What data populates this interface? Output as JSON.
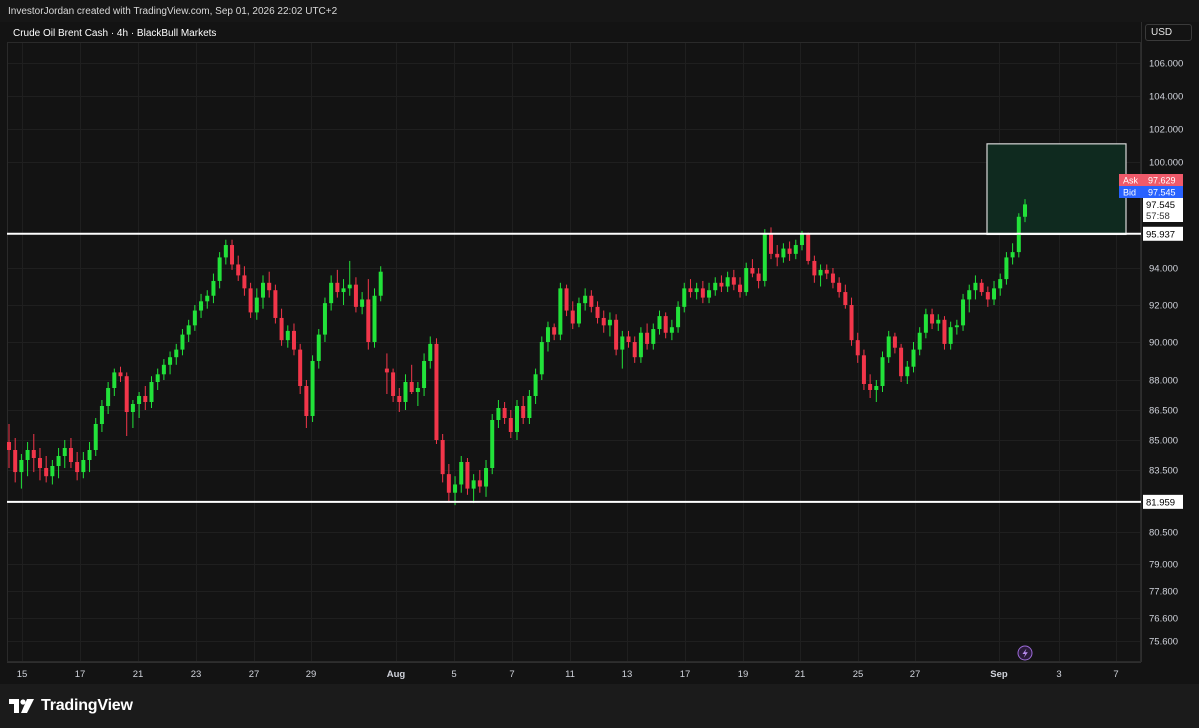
{
  "header": {
    "created_by": "InvestorJordan created with TradingView.com, Sep 01, 2026 22:02 UTC+2"
  },
  "chart_title": "Crude Oil Brent Cash · 4h · BlackBull Markets",
  "currency": "USD",
  "brand": {
    "name": "TradingView"
  },
  "colors": {
    "up": "#22e23a",
    "down": "#f2364a",
    "background": "#131313",
    "grid": "#1f1f1f",
    "ask": "#f05a6a",
    "bid": "#2962ff",
    "zone_fill": "#0f2a1f"
  },
  "chart_data": {
    "type": "candlestick",
    "instrument": "Crude Oil Brent Cash",
    "timeframe": "4h",
    "broker": "BlackBull Markets",
    "y_axis": {
      "range": [
        74.8,
        108.9
      ],
      "ticks": [
        "106.000",
        "104.000",
        "102.000",
        "100.000",
        "94.000",
        "92.000",
        "90.000",
        "88.000",
        "86.500",
        "85.000",
        "83.500",
        "80.500",
        "79.000",
        "77.800",
        "76.600",
        "75.600"
      ]
    },
    "x_axis": {
      "ticks": [
        "15",
        "17",
        "21",
        "23",
        "27",
        "29",
        "Aug",
        "5",
        "7",
        "11",
        "13",
        "17",
        "19",
        "21",
        "25",
        "27",
        "Sep",
        "3",
        "7"
      ]
    },
    "horizontal_levels": [
      {
        "price": 95.937,
        "label": "95.937"
      },
      {
        "price": 81.959,
        "label": "81.959"
      }
    ],
    "target_zone": {
      "top": 101.1,
      "bottom": 95.9,
      "from_date": "Sep 1",
      "to_date": "Sep 6"
    },
    "quote": {
      "ask_label": "Ask",
      "ask": "97.629",
      "bid_label": "Bid",
      "bid": "97.545",
      "last": "97.545",
      "countdown": "57:58"
    },
    "candles": [
      [
        84.9,
        85.8,
        83.6,
        84.5
      ],
      [
        84.5,
        85.1,
        82.9,
        83.4
      ],
      [
        83.4,
        84.3,
        82.6,
        84.0
      ],
      [
        84.0,
        84.9,
        83.2,
        84.5
      ],
      [
        84.5,
        85.3,
        83.4,
        84.1
      ],
      [
        84.1,
        84.6,
        83.0,
        83.6
      ],
      [
        83.6,
        84.2,
        82.9,
        83.2
      ],
      [
        83.2,
        84.0,
        82.8,
        83.7
      ],
      [
        83.7,
        84.6,
        83.1,
        84.2
      ],
      [
        84.2,
        85.0,
        83.6,
        84.6
      ],
      [
        84.6,
        85.1,
        83.6,
        83.9
      ],
      [
        83.9,
        84.4,
        83.0,
        83.4
      ],
      [
        83.4,
        84.4,
        83.1,
        84.0
      ],
      [
        84.0,
        84.9,
        83.4,
        84.5
      ],
      [
        84.5,
        86.1,
        84.2,
        85.8
      ],
      [
        85.8,
        87.0,
        85.4,
        86.7
      ],
      [
        86.7,
        87.9,
        86.3,
        87.6
      ],
      [
        87.6,
        88.6,
        87.2,
        88.4
      ],
      [
        88.4,
        88.7,
        87.9,
        88.2
      ],
      [
        88.2,
        88.4,
        85.2,
        86.4
      ],
      [
        86.4,
        87.0,
        85.6,
        86.8
      ],
      [
        86.8,
        87.4,
        86.1,
        87.2
      ],
      [
        87.2,
        87.7,
        86.5,
        86.9
      ],
      [
        86.9,
        88.2,
        86.6,
        87.9
      ],
      [
        87.9,
        88.6,
        87.5,
        88.3
      ],
      [
        88.3,
        89.1,
        88.0,
        88.8
      ],
      [
        88.8,
        89.5,
        88.3,
        89.2
      ],
      [
        89.2,
        89.9,
        88.8,
        89.6
      ],
      [
        89.6,
        90.7,
        89.3,
        90.4
      ],
      [
        90.4,
        91.2,
        90.0,
        90.9
      ],
      [
        90.9,
        92.0,
        90.6,
        91.7
      ],
      [
        91.7,
        92.6,
        91.3,
        92.2
      ],
      [
        92.2,
        92.8,
        91.8,
        92.5
      ],
      [
        92.5,
        93.7,
        92.1,
        93.3
      ],
      [
        93.3,
        94.9,
        92.9,
        94.6
      ],
      [
        94.6,
        95.6,
        94.2,
        95.3
      ],
      [
        95.3,
        95.6,
        93.9,
        94.2
      ],
      [
        94.2,
        94.7,
        93.3,
        93.6
      ],
      [
        93.6,
        94.1,
        92.5,
        92.9
      ],
      [
        92.9,
        93.2,
        91.3,
        91.6
      ],
      [
        91.6,
        92.9,
        91.2,
        92.4
      ],
      [
        92.4,
        93.6,
        91.8,
        93.2
      ],
      [
        93.2,
        93.8,
        92.4,
        92.8
      ],
      [
        92.8,
        93.1,
        91.0,
        91.3
      ],
      [
        91.3,
        91.8,
        89.8,
        90.1
      ],
      [
        90.1,
        90.9,
        89.7,
        90.6
      ],
      [
        90.6,
        91.0,
        89.3,
        89.6
      ],
      [
        89.6,
        89.9,
        87.3,
        87.7
      ],
      [
        87.7,
        88.0,
        85.6,
        86.2
      ],
      [
        86.2,
        89.3,
        85.9,
        89.0
      ],
      [
        89.0,
        90.7,
        88.6,
        90.4
      ],
      [
        90.4,
        92.4,
        90.0,
        92.1
      ],
      [
        92.1,
        93.6,
        91.7,
        93.2
      ],
      [
        93.2,
        93.9,
        92.4,
        92.7
      ],
      [
        92.7,
        93.4,
        92.0,
        92.9
      ],
      [
        92.9,
        94.4,
        92.5,
        93.1
      ],
      [
        93.1,
        93.5,
        91.6,
        91.9
      ],
      [
        91.9,
        92.7,
        91.5,
        92.3
      ],
      [
        92.3,
        93.4,
        89.6,
        90.0
      ],
      [
        90.0,
        92.9,
        89.7,
        92.5
      ],
      [
        92.5,
        94.1,
        92.2,
        93.8
      ],
      [
        88.6,
        89.4,
        87.3,
        88.4
      ],
      [
        88.4,
        88.6,
        86.9,
        87.2
      ],
      [
        87.2,
        87.6,
        86.4,
        86.9
      ],
      [
        86.9,
        88.3,
        86.5,
        87.9
      ],
      [
        87.9,
        88.8,
        87.3,
        87.4
      ],
      [
        87.4,
        87.9,
        86.7,
        87.6
      ],
      [
        87.6,
        89.4,
        87.2,
        89.0
      ],
      [
        89.0,
        90.3,
        88.6,
        89.9
      ],
      [
        89.9,
        90.2,
        84.8,
        85.0
      ],
      [
        85.0,
        85.3,
        82.9,
        83.3
      ],
      [
        83.3,
        83.8,
        82.0,
        82.4
      ],
      [
        82.4,
        83.2,
        81.8,
        82.8
      ],
      [
        82.8,
        84.2,
        82.4,
        83.9
      ],
      [
        83.9,
        84.1,
        82.3,
        82.6
      ],
      [
        82.6,
        83.3,
        81.9,
        83.0
      ],
      [
        83.0,
        83.5,
        82.4,
        82.7
      ],
      [
        82.7,
        84.0,
        82.2,
        83.6
      ],
      [
        83.6,
        86.3,
        83.3,
        86.0
      ],
      [
        86.0,
        87.0,
        85.6,
        86.6
      ],
      [
        86.6,
        86.9,
        85.8,
        86.1
      ],
      [
        86.1,
        86.5,
        85.1,
        85.4
      ],
      [
        85.4,
        87.0,
        85.0,
        86.7
      ],
      [
        86.7,
        87.2,
        85.8,
        86.1
      ],
      [
        86.1,
        87.5,
        85.8,
        87.2
      ],
      [
        87.2,
        88.6,
        86.8,
        88.3
      ],
      [
        88.3,
        90.3,
        88.0,
        90.0
      ],
      [
        90.0,
        91.1,
        89.5,
        90.8
      ],
      [
        90.8,
        91.0,
        90.1,
        90.4
      ],
      [
        90.4,
        93.2,
        90.1,
        92.9
      ],
      [
        92.9,
        93.1,
        91.4,
        91.7
      ],
      [
        91.7,
        92.2,
        90.7,
        91.0
      ],
      [
        91.0,
        92.4,
        90.8,
        92.1
      ],
      [
        92.1,
        92.9,
        91.7,
        92.5
      ],
      [
        92.5,
        92.8,
        91.6,
        91.9
      ],
      [
        91.9,
        92.2,
        91.0,
        91.3
      ],
      [
        91.3,
        91.7,
        90.5,
        90.9
      ],
      [
        90.9,
        91.6,
        90.3,
        91.2
      ],
      [
        91.2,
        91.5,
        89.3,
        89.6
      ],
      [
        89.6,
        90.6,
        88.6,
        90.3
      ],
      [
        90.3,
        90.6,
        89.7,
        90.0
      ],
      [
        90.0,
        90.3,
        88.9,
        89.2
      ],
      [
        89.2,
        90.8,
        88.9,
        90.5
      ],
      [
        90.5,
        91.0,
        89.6,
        89.9
      ],
      [
        89.9,
        91.0,
        89.6,
        90.7
      ],
      [
        90.7,
        91.7,
        90.4,
        91.4
      ],
      [
        91.4,
        91.6,
        90.2,
        90.5
      ],
      [
        90.5,
        91.2,
        90.1,
        90.8
      ],
      [
        90.8,
        92.2,
        90.5,
        91.9
      ],
      [
        91.9,
        93.2,
        91.6,
        92.9
      ],
      [
        92.9,
        93.4,
        92.4,
        92.7
      ],
      [
        92.7,
        93.2,
        92.3,
        92.9
      ],
      [
        92.9,
        93.3,
        92.1,
        92.4
      ],
      [
        92.4,
        93.2,
        92.1,
        92.8
      ],
      [
        92.8,
        93.5,
        92.5,
        93.2
      ],
      [
        93.2,
        93.6,
        92.7,
        93.0
      ],
      [
        93.0,
        93.8,
        92.7,
        93.5
      ],
      [
        93.5,
        93.9,
        92.8,
        93.1
      ],
      [
        93.1,
        93.5,
        92.4,
        92.7
      ],
      [
        92.7,
        94.3,
        92.5,
        94.0
      ],
      [
        94.0,
        94.5,
        93.5,
        93.7
      ],
      [
        93.7,
        94.0,
        92.9,
        93.3
      ],
      [
        93.3,
        96.2,
        93.0,
        95.9
      ],
      [
        95.9,
        96.3,
        94.5,
        94.8
      ],
      [
        94.8,
        95.3,
        94.1,
        94.6
      ],
      [
        94.6,
        95.4,
        94.3,
        95.1
      ],
      [
        95.1,
        95.5,
        94.4,
        94.8
      ],
      [
        94.8,
        95.6,
        94.5,
        95.3
      ],
      [
        95.3,
        96.1,
        95.0,
        95.9
      ],
      [
        95.9,
        96.0,
        94.2,
        94.4
      ],
      [
        94.4,
        94.7,
        93.2,
        93.6
      ],
      [
        93.6,
        94.2,
        93.0,
        93.9
      ],
      [
        93.9,
        94.2,
        93.4,
        93.7
      ],
      [
        93.7,
        94.0,
        92.9,
        93.2
      ],
      [
        93.2,
        93.5,
        92.4,
        92.7
      ],
      [
        92.7,
        93.1,
        91.8,
        92.0
      ],
      [
        92.0,
        92.4,
        89.8,
        90.1
      ],
      [
        90.1,
        90.5,
        88.9,
        89.3
      ],
      [
        89.3,
        89.6,
        87.5,
        87.8
      ],
      [
        87.8,
        88.3,
        87.1,
        87.5
      ],
      [
        87.5,
        88.0,
        86.9,
        87.7
      ],
      [
        87.7,
        89.5,
        87.4,
        89.2
      ],
      [
        89.2,
        90.6,
        88.9,
        90.3
      ],
      [
        90.3,
        90.5,
        89.4,
        89.7
      ],
      [
        89.7,
        89.9,
        87.9,
        88.2
      ],
      [
        88.2,
        89.0,
        87.8,
        88.7
      ],
      [
        88.7,
        90.0,
        88.4,
        89.6
      ],
      [
        89.6,
        90.8,
        89.3,
        90.5
      ],
      [
        90.5,
        91.8,
        90.2,
        91.5
      ],
      [
        91.5,
        91.8,
        90.7,
        91.0
      ],
      [
        91.0,
        91.5,
        90.6,
        91.2
      ],
      [
        91.2,
        91.4,
        89.6,
        89.9
      ],
      [
        89.9,
        91.1,
        89.6,
        90.8
      ],
      [
        90.8,
        91.2,
        90.4,
        90.9
      ],
      [
        90.9,
        92.6,
        90.6,
        92.3
      ],
      [
        92.3,
        93.1,
        91.6,
        92.8
      ],
      [
        92.8,
        93.6,
        92.3,
        93.2
      ],
      [
        93.2,
        93.4,
        92.5,
        92.7
      ],
      [
        92.7,
        93.0,
        91.9,
        92.3
      ],
      [
        92.3,
        93.3,
        92.0,
        92.9
      ],
      [
        92.9,
        93.7,
        92.5,
        93.4
      ],
      [
        93.4,
        94.9,
        93.1,
        94.6
      ],
      [
        94.6,
        95.4,
        94.2,
        94.9
      ],
      [
        94.9,
        97.1,
        94.6,
        96.9
      ],
      [
        96.9,
        97.9,
        96.6,
        97.6
      ]
    ]
  }
}
